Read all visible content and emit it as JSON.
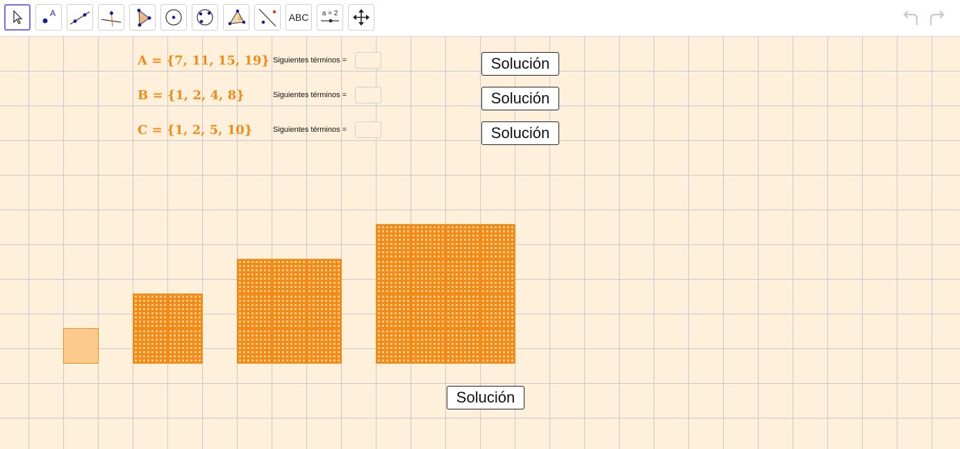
{
  "toolbar": {
    "tools": [
      {
        "name": "move-tool-icon"
      },
      {
        "name": "point-tool-icon",
        "glyph": "A"
      },
      {
        "name": "line-tool-icon"
      },
      {
        "name": "perpendicular-line-tool-icon"
      },
      {
        "name": "polygon-tool-icon"
      },
      {
        "name": "circle-center-point-tool-icon"
      },
      {
        "name": "circle-three-points-tool-icon"
      },
      {
        "name": "angle-tool-icon"
      },
      {
        "name": "reflect-tool-icon"
      },
      {
        "name": "text-tool-icon",
        "label": "ABC"
      },
      {
        "name": "slider-tool-icon",
        "label": "a = 2"
      },
      {
        "name": "move-graphics-view-tool-icon"
      }
    ],
    "undo": "undo-icon",
    "redo": "redo-icon"
  },
  "sets": [
    {
      "text": "A  =  {7, 11, 15, 19}"
    },
    {
      "text": "B  =  {1, 2, 4, 8}"
    },
    {
      "text": "C  =  {1, 2, 5, 10}"
    }
  ],
  "terms_label": "Siguientes términos =",
  "terms_inputs": [
    "",
    "",
    ""
  ],
  "solution_label": "Solución",
  "figure_sequence": {
    "description_counts": [
      1,
      2,
      3,
      4
    ]
  },
  "colors": {
    "accent": "#f28a16",
    "square_fill": "#fdca8e",
    "canvas_bg": "#fef0da",
    "selected_tool_border": "#6e6ee6"
  }
}
